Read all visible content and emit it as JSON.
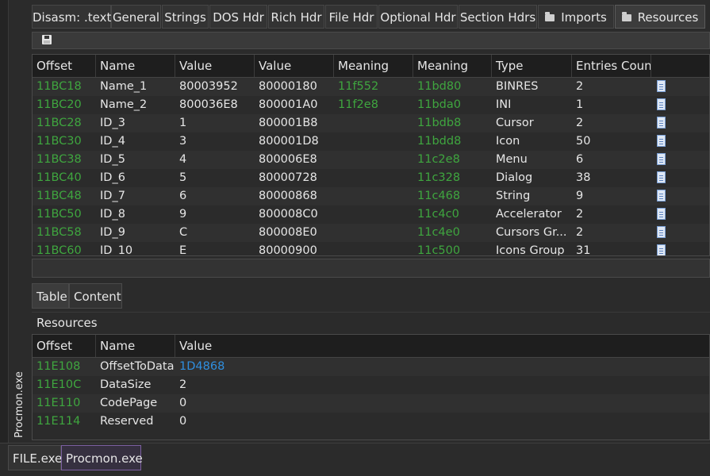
{
  "top_tabs": [
    {
      "label": "Disasm: .text",
      "active": false,
      "icon": null
    },
    {
      "label": "General",
      "active": false,
      "icon": null
    },
    {
      "label": "Strings",
      "active": false,
      "icon": null
    },
    {
      "label": "DOS Hdr",
      "active": false,
      "icon": null
    },
    {
      "label": "Rich Hdr",
      "active": false,
      "icon": null
    },
    {
      "label": "File Hdr",
      "active": false,
      "icon": null
    },
    {
      "label": "Optional Hdr",
      "active": false,
      "icon": null
    },
    {
      "label": "Section Hdrs",
      "active": false,
      "icon": null
    },
    {
      "label": "Imports",
      "active": false,
      "icon": "folder-icon"
    },
    {
      "label": "Resources",
      "active": true,
      "icon": "folder-icon"
    }
  ],
  "toolbar": {
    "save_icon": "save-icon"
  },
  "resource_table": {
    "headers": [
      "Offset",
      "Name",
      "Value",
      "Value",
      "Meaning",
      "Meaning",
      "Type",
      "Entries Count"
    ],
    "rows": [
      {
        "offset": "11BC18",
        "name": "Name_1",
        "value1": "80003952",
        "value2": "80000180",
        "meaning1": "11f552",
        "meaning2": "11bd80",
        "type": "BINRES",
        "count": "2"
      },
      {
        "offset": "11BC20",
        "name": "Name_2",
        "value1": "800036E8",
        "value2": "800001A0",
        "meaning1": "11f2e8",
        "meaning2": "11bda0",
        "type": "INI",
        "count": "1"
      },
      {
        "offset": "11BC28",
        "name": "ID_3",
        "value1": "1",
        "value2": "800001B8",
        "meaning1": "",
        "meaning2": "11bdb8",
        "type": "Cursor",
        "count": "2"
      },
      {
        "offset": "11BC30",
        "name": "ID_4",
        "value1": "3",
        "value2": "800001D8",
        "meaning1": "",
        "meaning2": "11bdd8",
        "type": "Icon",
        "count": "50"
      },
      {
        "offset": "11BC38",
        "name": "ID_5",
        "value1": "4",
        "value2": "800006E8",
        "meaning1": "",
        "meaning2": "11c2e8",
        "type": "Menu",
        "count": "6"
      },
      {
        "offset": "11BC40",
        "name": "ID_6",
        "value1": "5",
        "value2": "80000728",
        "meaning1": "",
        "meaning2": "11c328",
        "type": "Dialog",
        "count": "38"
      },
      {
        "offset": "11BC48",
        "name": "ID_7",
        "value1": "6",
        "value2": "80000868",
        "meaning1": "",
        "meaning2": "11c468",
        "type": "String",
        "count": "9"
      },
      {
        "offset": "11BC50",
        "name": "ID_8",
        "value1": "9",
        "value2": "800008C0",
        "meaning1": "",
        "meaning2": "11c4c0",
        "type": "Accelerator",
        "count": "2"
      },
      {
        "offset": "11BC58",
        "name": "ID_9",
        "value1": "C",
        "value2": "800008E0",
        "meaning1": "",
        "meaning2": "11c4e0",
        "type": "Cursors Gr...",
        "count": "2"
      },
      {
        "offset": "11BC60",
        "name": "ID_10",
        "value1": "E",
        "value2": "80000900",
        "meaning1": "",
        "meaning2": "11c500",
        "type": "Icons Group",
        "count": "31"
      }
    ]
  },
  "sub_tabs": [
    {
      "label": "Table",
      "active": true
    },
    {
      "label": "Content",
      "active": false
    }
  ],
  "section_label": "Resources",
  "detail_table": {
    "headers": [
      "Offset",
      "Name",
      "Value"
    ],
    "rows": [
      {
        "offset": "11E108",
        "name": "OffsetToData",
        "value": "1D4868",
        "value_color": "blue"
      },
      {
        "offset": "11E10C",
        "name": "DataSize",
        "value": "2",
        "value_color": ""
      },
      {
        "offset": "11E110",
        "name": "CodePage",
        "value": "0",
        "value_color": ""
      },
      {
        "offset": "11E114",
        "name": "Reserved",
        "value": "0",
        "value_color": ""
      }
    ]
  },
  "vertical_tab": {
    "label": "Procmon.exe"
  },
  "bottom_tabs": [
    {
      "label": "FILE.exe",
      "active": false
    },
    {
      "label": "Procmon.exe",
      "active": true
    }
  ],
  "colors": {
    "address_green": "#3fa63f",
    "link_blue": "#2f8fe0",
    "accent_purple": "#7b5fa0"
  }
}
